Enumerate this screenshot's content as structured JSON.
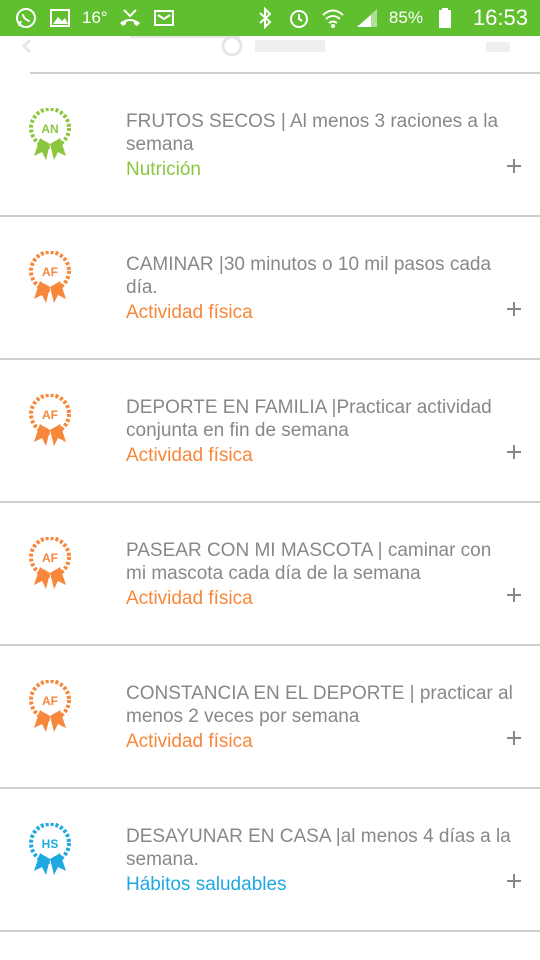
{
  "status_bar": {
    "left_icons": [
      "whatsapp-icon",
      "gallery-icon",
      "temperature-icon",
      "missed-call-icon",
      "news-icon"
    ],
    "temperature": "16°",
    "right_icons": [
      "bluetooth-icon",
      "alarm-icon",
      "wifi-icon",
      "signal-icon",
      "battery-icon"
    ],
    "battery": "85%",
    "time": "16:53"
  },
  "colors": {
    "status_bar": "#5fbf2f",
    "nutricion": "#8cc63f",
    "actividad_fisica": "#f7873a",
    "habitos_saludables": "#1fa9e1",
    "title_text": "#888888",
    "divider": "#cfcfcf"
  },
  "challenges": [
    {
      "badge": "AN",
      "title": "FRUTOS SECOS | Al menos 3 raciones a la semana",
      "category": "Nutrición",
      "color": "#8cc63f"
    },
    {
      "badge": "AF",
      "title": "CAMINAR |30 minutos o 10 mil pasos cada día.",
      "category": "Actividad física",
      "color": "#f7873a"
    },
    {
      "badge": "AF",
      "title": "DEPORTE EN FAMILIA |Practicar actividad conjunta en fin de semana",
      "category": "Actividad física",
      "color": "#f7873a"
    },
    {
      "badge": "AF",
      "title": "PASEAR CON MI MASCOTA | caminar con mi mascota cada día de la semana",
      "category": "Actividad física",
      "color": "#f7873a"
    },
    {
      "badge": "AF",
      "title": "CONSTANCIA EN EL DEPORTE | practicar al menos 2 veces por semana",
      "category": "Actividad física",
      "color": "#f7873a"
    },
    {
      "badge": "HS",
      "title": "DESAYUNAR EN CASA |al menos 4 días a la semana.",
      "category": "Hábitos saludables",
      "color": "#1fa9e1"
    }
  ]
}
